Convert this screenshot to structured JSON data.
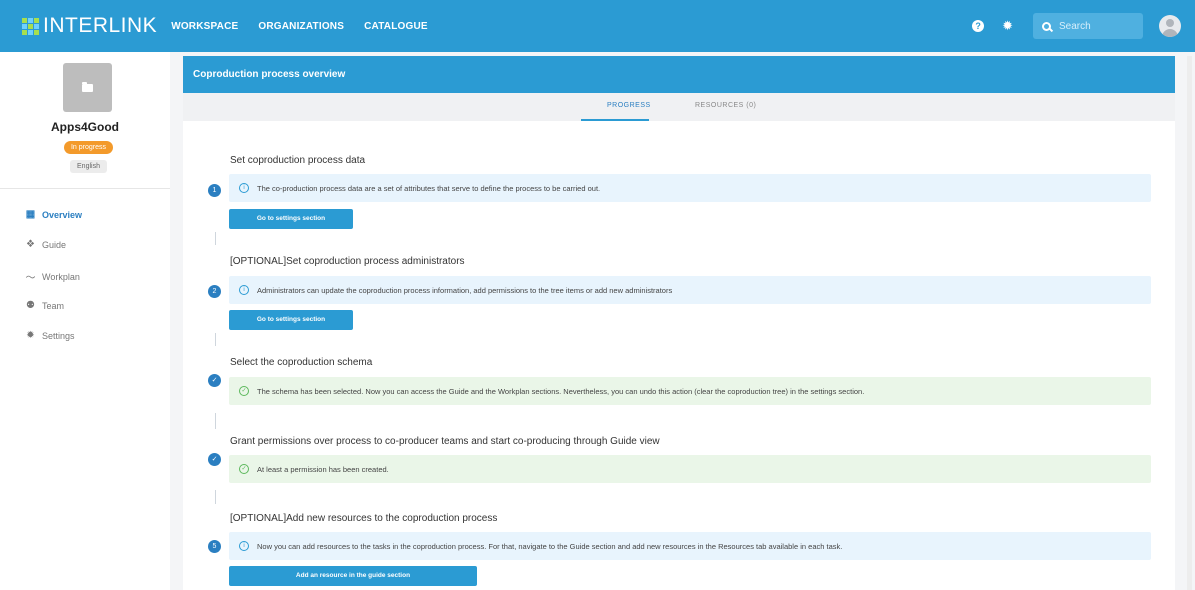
{
  "topbar": {
    "logo_text": "INTERLINK",
    "nav": [
      "WORKSPACE",
      "ORGANIZATIONS",
      "CATALOGUE"
    ],
    "help_icon": "?",
    "search_placeholder": "Search"
  },
  "sidebar": {
    "project_name": "Apps4Good",
    "status": "In progress",
    "language": "English",
    "items": [
      {
        "icon": "grid-icon",
        "label": "Overview",
        "active": true
      },
      {
        "icon": "guide-icon",
        "label": "Guide"
      },
      {
        "icon": "workplan-icon",
        "label": "Workplan"
      },
      {
        "icon": "team-icon",
        "label": "Team"
      },
      {
        "icon": "settings-icon",
        "label": "Settings"
      }
    ]
  },
  "main": {
    "header": "Coproduction process overview",
    "tabs": [
      "PROGRESS",
      "RESOURCES (0)"
    ],
    "steps": [
      {
        "number": "1",
        "title": "Set coproduction process data",
        "alert_type": "info",
        "alert_text": "The co-production process data are a set of attributes that serve to define the process to be carried out.",
        "button": "Go to settings section"
      },
      {
        "number": "2",
        "title": "[OPTIONAL]Set coproduction process administrators",
        "alert_type": "info",
        "alert_text": "Administrators can update the coproduction process information, add permissions to the tree items or add new administrators",
        "button": "Go to settings section"
      },
      {
        "number": "✓",
        "title": "Select the coproduction schema",
        "alert_type": "success",
        "alert_text": "The schema has been selected. Now you can access the Guide and the Workplan sections. Nevertheless, you can undo this action (clear the coproduction tree) in the settings section."
      },
      {
        "number": "✓",
        "title": "Grant permissions over process to co-producer teams and start co-producing through Guide view",
        "alert_type": "success",
        "alert_text": "At least a permission has been created."
      },
      {
        "number": "5",
        "title": "[OPTIONAL]Add new resources to the coproduction process",
        "alert_type": "info",
        "alert_text": "Now you can add resources to the tasks in the coproduction process. For that, navigate to the Guide section and add new resources in the Resources tab available in each task.",
        "button": "Add an resource in the guide section"
      }
    ]
  }
}
